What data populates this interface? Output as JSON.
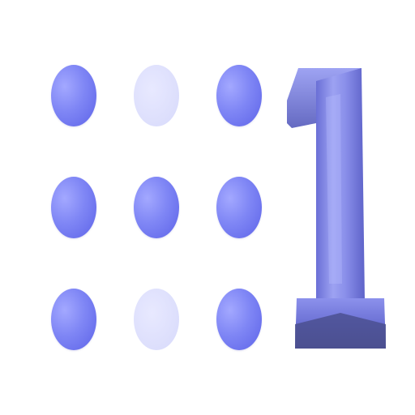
{
  "icon": {
    "type": "nine-dot-grid-with-numeral-one",
    "numeral": "1",
    "colors": {
      "dot_filled": "#7f86f5",
      "dot_faded": "#dcdefc",
      "numeral_body": "#7e83e0",
      "numeral_shadow": "#4a4f8c"
    },
    "grid": {
      "rows": 3,
      "cols": 3,
      "cells": [
        {
          "state": "filled"
        },
        {
          "state": "faded"
        },
        {
          "state": "filled"
        },
        {
          "state": "filled"
        },
        {
          "state": "filled"
        },
        {
          "state": "filled"
        },
        {
          "state": "filled"
        },
        {
          "state": "faded"
        },
        {
          "state": "filled"
        }
      ]
    }
  }
}
